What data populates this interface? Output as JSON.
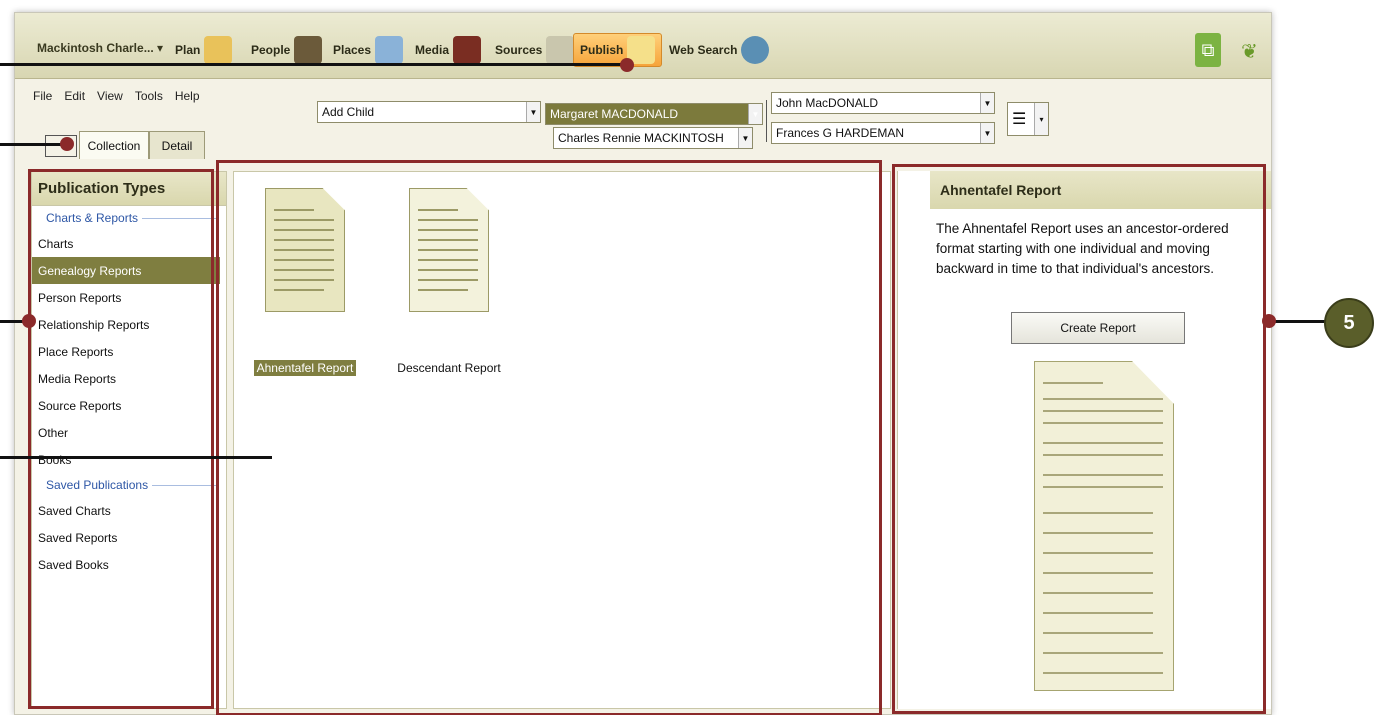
{
  "topbar": {
    "tree_name": "Mackintosh Charle...",
    "nav": [
      "Plan",
      "People",
      "Places",
      "Media",
      "Sources",
      "Publish",
      "Web Search"
    ],
    "active": "Publish"
  },
  "menu": [
    "File",
    "Edit",
    "View",
    "Tools",
    "Help"
  ],
  "tabs": [
    "Collection",
    "Detail"
  ],
  "pedigree": {
    "add_child": "Add Child",
    "parent": "Margaret MACDONALD",
    "child": "Charles Rennie MACKINTOSH",
    "father": "John MacDONALD",
    "mother": "Frances G HARDEMAN"
  },
  "publication_types": {
    "title": "Publication Types",
    "section1": "Charts & Reports",
    "items1": [
      "Charts",
      "Genealogy Reports",
      "Person Reports",
      "Relationship Reports",
      "Place Reports",
      "Media Reports",
      "Source Reports",
      "Other",
      "Books"
    ],
    "selected": "Genealogy Reports",
    "section2": "Saved Publications",
    "items2": [
      "Saved Charts",
      "Saved Reports",
      "Saved Books"
    ]
  },
  "reports": [
    "Ahnentafel Report",
    "Descendant Report"
  ],
  "selected_report": "Ahnentafel Report",
  "detail": {
    "title": "Ahnentafel Report",
    "description": "The Ahnentafel Report uses an ancestor-ordered format starting with one individual and moving backward in time to that individual's ancestors.",
    "create_label": "Create Report"
  },
  "badge": "5",
  "colors": {
    "accent": "#7f7e40",
    "annotation": "#8b2a2a",
    "badge": "#5a5e2a"
  }
}
